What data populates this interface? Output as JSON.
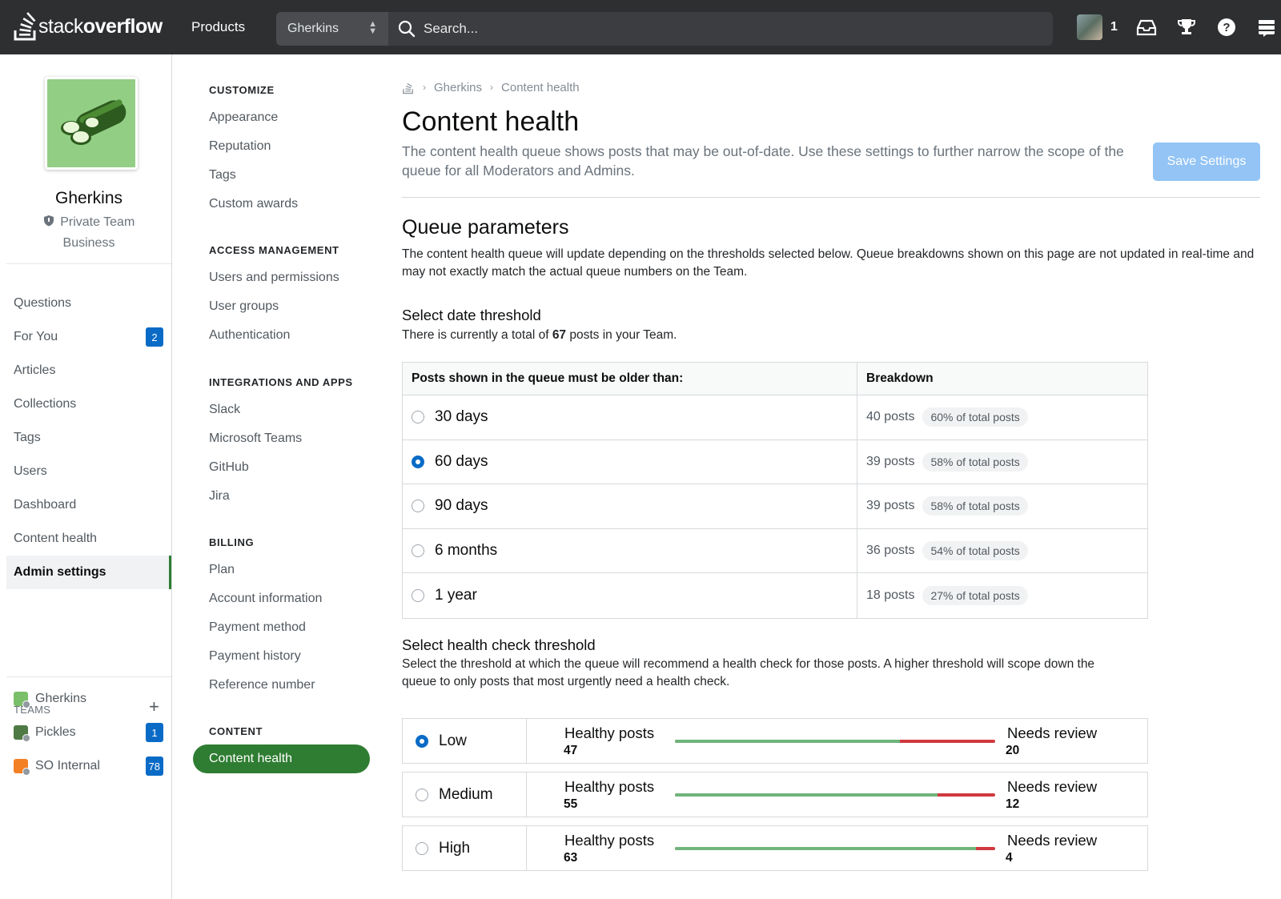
{
  "header": {
    "logo_thin": "stack",
    "logo_bold": "overflow",
    "products": "Products",
    "team_select": "Gherkins",
    "search_placeholder": "Search...",
    "reputation": "1"
  },
  "team": {
    "name": "Gherkins",
    "type": "Private Team",
    "plan": "Business"
  },
  "nav": [
    {
      "label": "Questions"
    },
    {
      "label": "For You",
      "badge": "2"
    },
    {
      "label": "Articles"
    },
    {
      "label": "Collections"
    },
    {
      "label": "Tags"
    },
    {
      "label": "Users"
    },
    {
      "label": "Dashboard"
    },
    {
      "label": "Content health"
    },
    {
      "label": "Admin settings"
    }
  ],
  "teams": {
    "label": "TEAMS",
    "items": [
      {
        "name": "Gherkins",
        "color": "#7bbf6a"
      },
      {
        "name": "Pickles",
        "badge": "1",
        "color": "#4f7a45"
      },
      {
        "name": "SO Internal",
        "badge": "78",
        "color": "#f48024"
      }
    ]
  },
  "settings_nav": {
    "customize": {
      "head": "CUSTOMIZE",
      "items": [
        "Appearance",
        "Reputation",
        "Tags",
        "Custom awards"
      ]
    },
    "access": {
      "head": "ACCESS MANAGEMENT",
      "items": [
        "Users and permissions",
        "User groups",
        "Authentication"
      ]
    },
    "integrations": {
      "head": "INTEGRATIONS AND APPS",
      "items": [
        "Slack",
        "Microsoft Teams",
        "GitHub",
        "Jira"
      ]
    },
    "billing": {
      "head": "BILLING",
      "items": [
        "Plan",
        "Account information",
        "Payment method",
        "Payment history",
        "Reference number"
      ]
    },
    "content": {
      "head": "CONTENT",
      "active": "Content health"
    }
  },
  "main": {
    "breadcrumb": [
      "Gherkins",
      "Content health"
    ],
    "title": "Content health",
    "description": "The content health queue shows posts that may be out-of-date. Use these settings to further narrow the scope of the queue for all Moderators and Admins.",
    "save_label": "Save Settings",
    "queue_title": "Queue parameters",
    "queue_desc": "The content health queue will update depending on the thresholds selected below. Queue breakdowns shown on this page are not updated in real-time and may not exactly match the actual queue numbers on the Team.",
    "date_title": "Select date threshold",
    "date_desc_pre": "There is currently a total of ",
    "date_total": "67",
    "date_desc_post": " posts in your Team.",
    "date_col1": "Posts shown in the queue must be older than:",
    "date_col2": "Breakdown",
    "date_options": [
      {
        "label": "30 days",
        "posts": "40 posts",
        "pct": "60% of total posts",
        "checked": false
      },
      {
        "label": "60 days",
        "posts": "39 posts",
        "pct": "58% of total posts",
        "checked": true
      },
      {
        "label": "90 days",
        "posts": "39 posts",
        "pct": "58% of total posts",
        "checked": false
      },
      {
        "label": "6 months",
        "posts": "36 posts",
        "pct": "54% of total posts",
        "checked": false
      },
      {
        "label": "1 year",
        "posts": "18 posts",
        "pct": "27% of total posts",
        "checked": false
      }
    ],
    "health_title": "Select health check threshold",
    "health_desc": "Select the threshold at which the queue will recommend a health check for those posts. A higher threshold will scope down the queue to only posts that most urgently need a health check.",
    "healthy_label": "Healthy posts",
    "review_label": "Needs review",
    "health_options": [
      {
        "label": "Low",
        "healthy": "47",
        "review": "20",
        "checked": true
      },
      {
        "label": "Medium",
        "healthy": "55",
        "review": "12",
        "checked": false
      },
      {
        "label": "High",
        "healthy": "63",
        "review": "4",
        "checked": false
      }
    ]
  },
  "colors": {
    "accent_green": "#2f7d32",
    "badge_blue": "#0a6bc6",
    "healthy_bar": "#6fb57b",
    "review_bar": "#d0393e"
  }
}
